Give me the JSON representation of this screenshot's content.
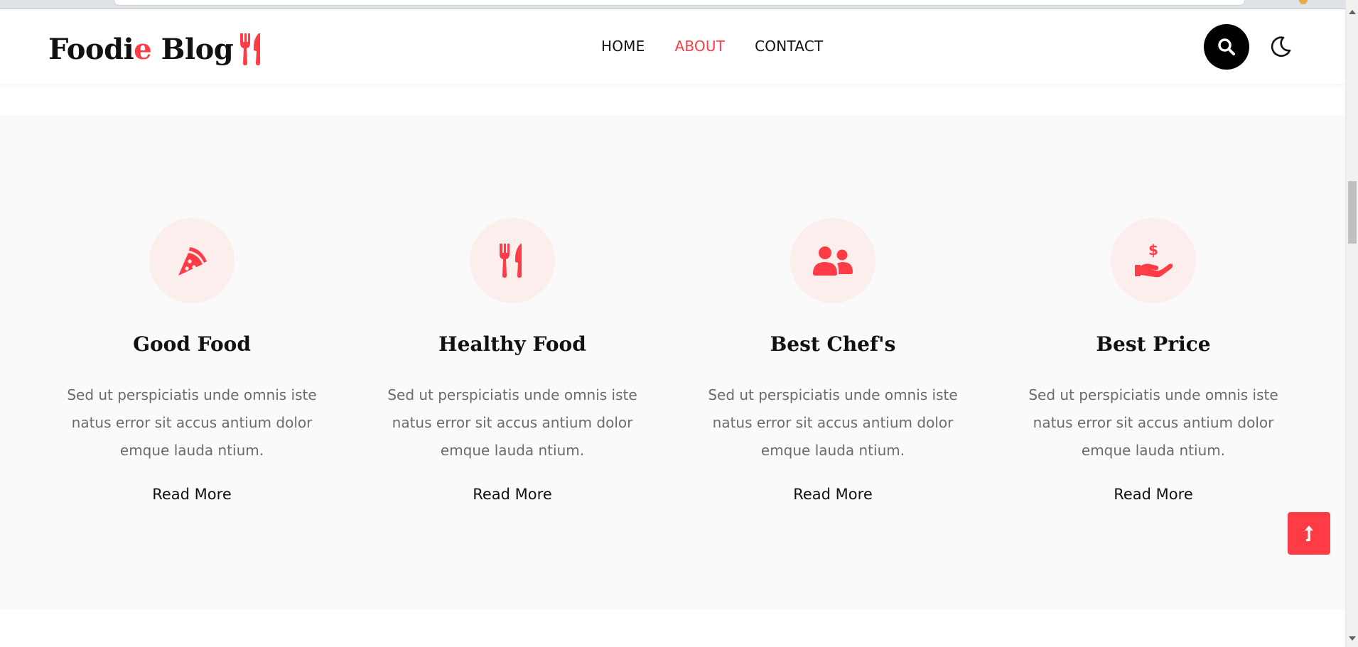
{
  "site": {
    "logo_main": "Foodi",
    "logo_accent": "e",
    "logo_tail": " Blog",
    "accent_color": "#ff3c46"
  },
  "nav": {
    "items": [
      {
        "label": "HOME",
        "active": false
      },
      {
        "label": "ABOUT",
        "active": true
      },
      {
        "label": "CONTACT",
        "active": false
      }
    ]
  },
  "header_actions": {
    "search_icon": "search-icon",
    "theme_icon": "moon-icon"
  },
  "features": [
    {
      "icon": "pizza-slice-icon",
      "title": "Good Food",
      "text": "Sed ut perspiciatis unde omnis iste natus error sit accus antium dolor emque lauda ntium.",
      "link": "Read More"
    },
    {
      "icon": "utensils-icon",
      "title": "Healthy Food",
      "text": "Sed ut perspiciatis unde omnis iste natus error sit accus antium dolor emque lauda ntium.",
      "link": "Read More"
    },
    {
      "icon": "users-icon",
      "title": "Best Chef's",
      "text": "Sed ut perspiciatis unde omnis iste natus error sit accus antium dolor emque lauda ntium.",
      "link": "Read More"
    },
    {
      "icon": "hand-holding-dollar-icon",
      "title": "Best Price",
      "text": "Sed ut perspiciatis unde omnis iste natus error sit accus antium dolor emque lauda ntium.",
      "link": "Read More"
    }
  ],
  "scroll_top": {
    "icon": "arrow-up-icon"
  }
}
